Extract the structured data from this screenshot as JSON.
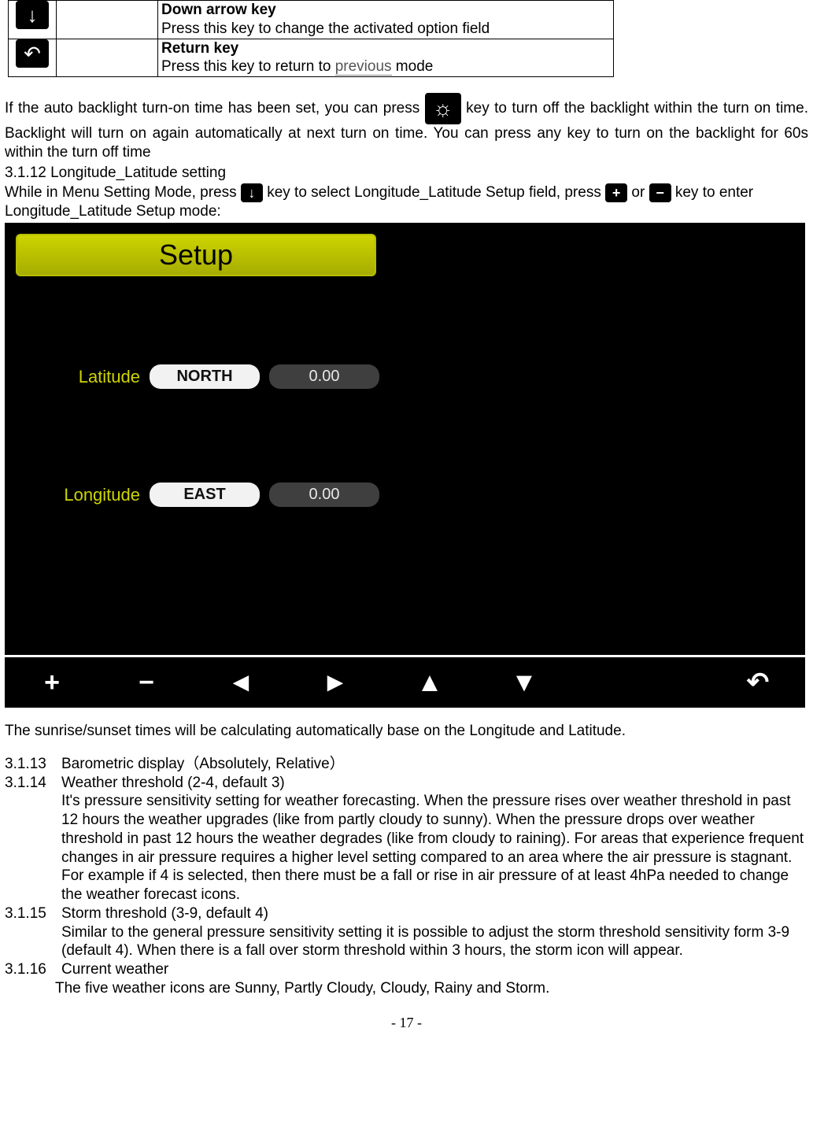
{
  "keytable": {
    "row1": {
      "icon": "↓",
      "title": "Down arrow key",
      "desc": "Press this key to change the activated option field"
    },
    "row2": {
      "icon": "↶",
      "title": "Return key",
      "desc_a": "Press this key to return to ",
      "desc_prev": "previous",
      "desc_b": " mode"
    }
  },
  "para1_a": "If the auto backlight turn-on time has been set, you can press ",
  "para1_icon": "☼",
  "para1_b": " key to turn off the backlight within the turn on time. Backlight will turn on again automatically at next turn on time. You can press any key to turn on the backlight for 60s within the turn off time",
  "heading_3_1_12": "3.1.12  Longitude_Latitude setting",
  "para2_a": "While in Menu Setting Mode, press ",
  "para2_icon1": "↓",
  "para2_b": " key to select Longitude_Latitude Setup field, press ",
  "para2_icon2": "+",
  "para2_c": " or ",
  "para2_icon3": "−",
  "para2_d": " key to enter Longitude_Latitude Setup mode:",
  "setup": {
    "title": "Setup",
    "lat_label": "Latitude",
    "lat_dir": "NORTH",
    "lat_val": "0.00",
    "lon_label": "Longitude",
    "lon_dir": "EAST",
    "lon_val": "0.00",
    "btns": {
      "plus": "+",
      "minus": "−",
      "left": "◄",
      "right": "►",
      "up": "▲",
      "down": "▼",
      "back": "↶"
    }
  },
  "afterimg": "The sunrise/sunset times will be calculating automatically base on the Longitude and Latitude.",
  "s3113_num": "3.1.13",
  "s3113_title": "Barometric display（Absolutely, Relative）",
  "s3114_num": "3.1.14",
  "s3114_title": "Weather threshold (2-4, default 3)",
  "s3114_body": "It's pressure sensitivity setting for weather forecasting. When the pressure rises over weather threshold in past 12 hours the weather upgrades (like from partly cloudy to sunny). When the pressure drops over weather threshold in past 12 hours the weather degrades (like from cloudy to raining). For areas that experience frequent changes in air pressure requires a higher level setting compared to an area where the air pressure is stagnant. For example if 4 is selected, then there must be a fall or rise in air pressure of at least 4hPa needed to change the weather forecast icons.",
  "s3115_num": "3.1.15",
  "s3115_title": "Storm threshold (3-9, default 4)",
  "s3115_body": "Similar to the general pressure sensitivity setting it is possible to adjust the storm threshold sensitivity form 3-9 (default 4). When there is a fall over storm threshold within 3 hours, the storm icon will appear.",
  "s3116_num": "3.1.16",
  "s3116_title": "Current weather",
  "s3116_body": "The five weather icons are Sunny, Partly Cloudy, Cloudy, Rainy and Storm.",
  "footer": "- 17 -"
}
